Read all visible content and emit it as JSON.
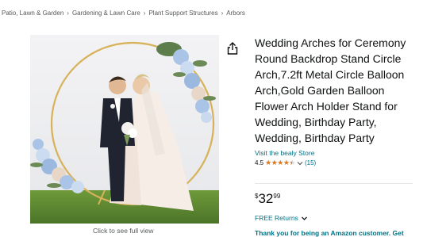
{
  "breadcrumb": [
    "Patio, Lawn & Garden",
    "Gardening & Lawn Care",
    "Plant Support Structures",
    "Arbors"
  ],
  "breadcrumb_separator": "›",
  "image": {
    "caption": "Click to see full view"
  },
  "product": {
    "title": "Wedding Arches for Ceremony Round Backdrop Stand Circle Arch,7.2ft Metal Circle Balloon Arch,Gold Garden Balloon Flower Arch Holder Stand for Wedding, Birthday Party, Wedding, Birthday Party",
    "store_link": "Visit the bealy Store",
    "rating": "4.5",
    "rating_value": 4.5,
    "review_count": "(15)",
    "price": {
      "symbol": "$",
      "whole": "32",
      "fraction": "99"
    },
    "returns": "FREE Returns",
    "promo": "Thank you for being an Amazon customer. Get"
  },
  "colors": {
    "link": "#007185",
    "star": "#de7921",
    "muted": "#565959"
  },
  "icons": {
    "share": "share-icon",
    "chevron": "chevron-down-icon"
  }
}
